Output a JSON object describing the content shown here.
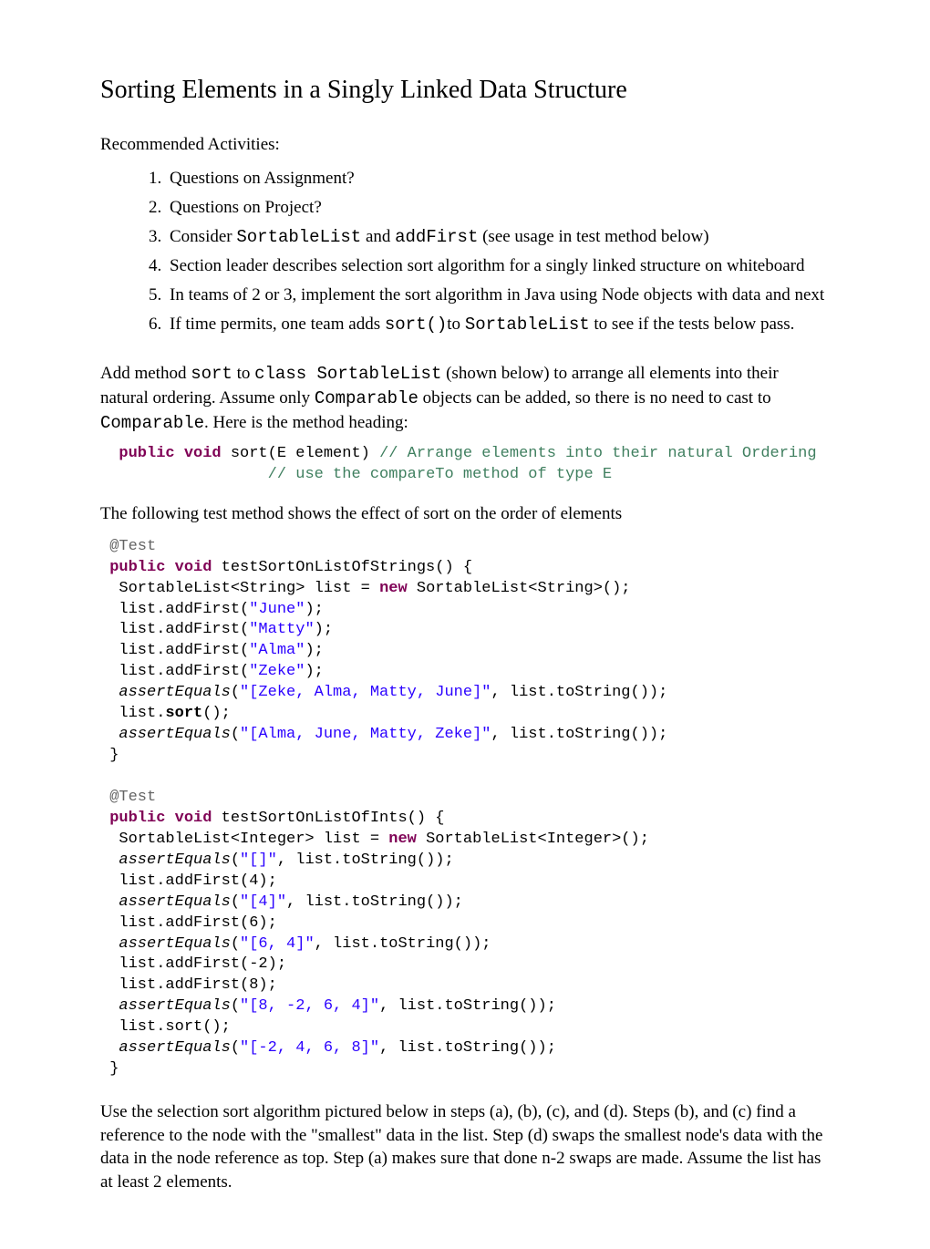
{
  "title": "Sorting Elements in a Singly Linked Data Structure",
  "recommendedLabel": "Recommended Activities:",
  "activities": {
    "item1": "Questions on Assignment?",
    "item2": "Questions on Project?",
    "item3_pre": "Consider ",
    "item3_code1": "SortableList",
    "item3_mid": " and ",
    "item3_code2": "addFirst",
    "item3_post": " (see usage in test method below)",
    "item4": "Section leader describes selection sort algorithm for a singly linked structure on whiteboard",
    "item5": "In teams of 2 or 3, implement the sort algorithm in Java using Node objects with data and next",
    "item6_pre": "If time permits, one team adds ",
    "item6_code1": "sort()",
    "item6_mid": "to ",
    "item6_code2": "SortableList",
    "item6_post": " to see if the tests below pass."
  },
  "para1": {
    "t1": "Add method ",
    "c1": "sort",
    "t2": " to ",
    "c2": "class SortableList",
    "t3": "  (shown below) to arrange all elements into their natural ordering. Assume only ",
    "c3": "Comparable",
    "t4": " objects can be added, so there is no need to cast to ",
    "c4": "Comparable",
    "t5": ". Here is the method heading:"
  },
  "sig": {
    "pad1": "  ",
    "kw": "public void",
    "rest": " sort(E element) ",
    "com1": "// Arrange elements into their natural Ordering",
    "pad2": "                  ",
    "com2": "// use the compareTo method of type E"
  },
  "para2": "The following test method shows the effect of sort on the order of elements",
  "code": {
    "l01a": " ",
    "l01b": "@Test",
    "l02a": " ",
    "l02kw": "public void",
    "l02r": " testSortOnListOfStrings() {",
    "l03a": "  SortableList<String> list = ",
    "l03kw": "new",
    "l03r": " SortableList<String>();",
    "l04a": "  list.addFirst(",
    "l04s": "\"June\"",
    "l04r": ");",
    "l05a": "  list.addFirst(",
    "l05s": "\"Matty\"",
    "l05r": ");",
    "l06a": "  list.addFirst(",
    "l06s": "\"Alma\"",
    "l06r": ");",
    "l07a": "  list.addFirst(",
    "l07s": "\"Zeke\"",
    "l07r": ");",
    "l08a": "  ",
    "l08i": "assertEquals",
    "l08b": "(",
    "l08s": "\"[Zeke, Alma, Matty, June]\"",
    "l08r": ", list.toString());",
    "l09a": "  list.",
    "l09b": "sort",
    "l09r": "();",
    "l10a": "  ",
    "l10i": "assertEquals",
    "l10b": "(",
    "l10s": "\"[Alma, June, Matty, Zeke]\"",
    "l10r": ", list.toString());",
    "l11": " }",
    "blank": " ",
    "l12a": " ",
    "l12b": "@Test",
    "l13a": " ",
    "l13kw": "public void",
    "l13r": " testSortOnListOfInts() {",
    "l14a": "  SortableList<Integer> list = ",
    "l14kw": "new",
    "l14r": " SortableList<Integer>();",
    "l15a": "  ",
    "l15i": "assertEquals",
    "l15b": "(",
    "l15s": "\"[]\"",
    "l15r": ", list.toString());",
    "l16": "  list.addFirst(4);",
    "l17a": "  ",
    "l17i": "assertEquals",
    "l17b": "(",
    "l17s": "\"[4]\"",
    "l17r": ", list.toString());",
    "l18": "  list.addFirst(6);",
    "l19a": "  ",
    "l19i": "assertEquals",
    "l19b": "(",
    "l19s": "\"[6, 4]\"",
    "l19r": ", list.toString());",
    "l20": "  list.addFirst(-2);",
    "l21": "  list.addFirst(8);",
    "l22a": "  ",
    "l22i": "assertEquals",
    "l22b": "(",
    "l22s": "\"[8, -2, 6, 4]\"",
    "l22r": ", list.toString());",
    "l23": "  list.sort();",
    "l24a": "  ",
    "l24i": "assertEquals",
    "l24b": "(",
    "l24s": "\"[-2, 4, 6, 8]\"",
    "l24r": ", list.toString());",
    "l25": " }"
  },
  "para3": "Use the selection sort algorithm pictured below in steps (a), (b), (c), and (d). Steps (b), and (c) find a reference to the node with the \"smallest\" data in the list. Step (d) swaps the smallest node's data with the data in the node reference as top. Step (a) makes sure that done n-2 swaps are made. Assume the list has at least 2 elements."
}
